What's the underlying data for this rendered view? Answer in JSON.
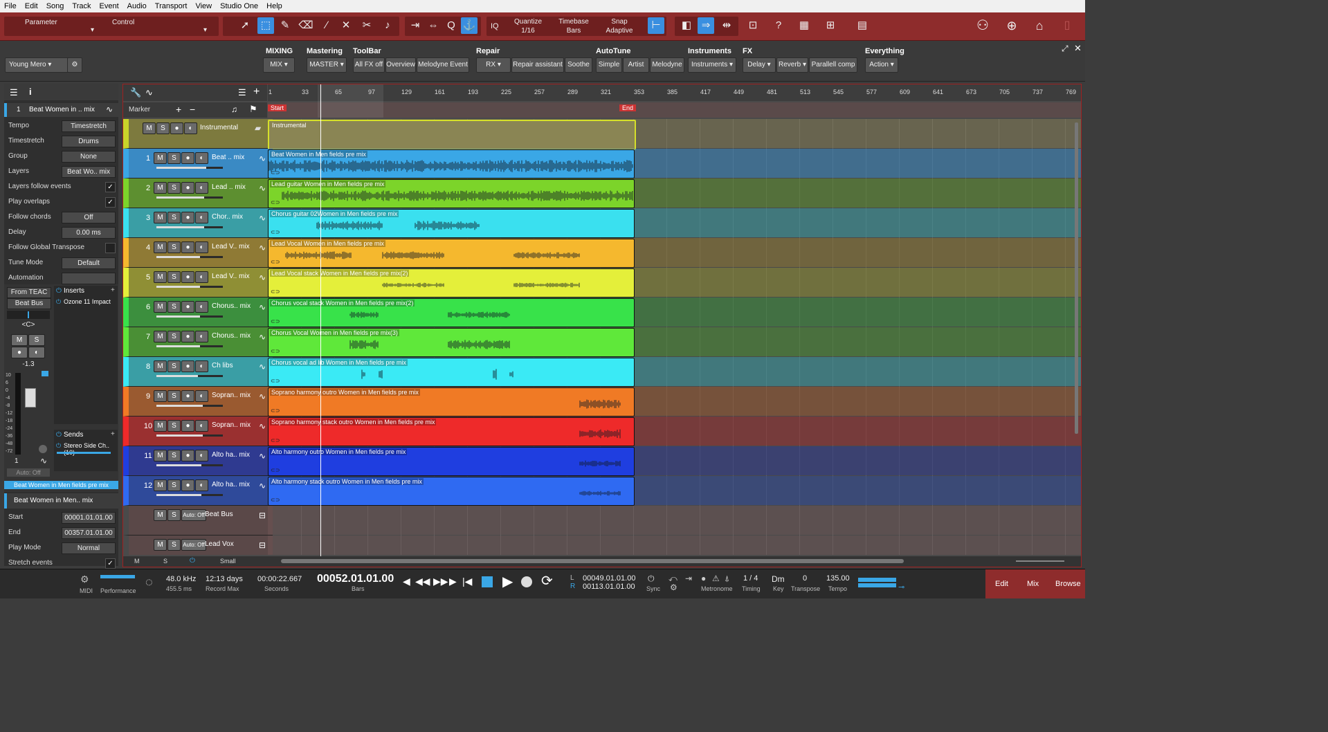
{
  "menu": [
    "File",
    "Edit",
    "Song",
    "Track",
    "Event",
    "Audio",
    "Transport",
    "View",
    "Studio One",
    "Help"
  ],
  "toolbar": {
    "parameter_label": "Parameter",
    "control_label": "Control",
    "quantize_label": "Quantize",
    "quantize_value": "1/16",
    "timebase_label": "Timebase",
    "timebase_value": "Bars",
    "snap_label": "Snap",
    "snap_value": "Adaptive",
    "iq": "IQ"
  },
  "macro": {
    "preset": "Young Mero",
    "groups": [
      {
        "title": "MIXING",
        "buttons": [
          "MIX"
        ]
      },
      {
        "title": "Mastering",
        "buttons": [
          "MASTER"
        ]
      },
      {
        "title": "ToolBar",
        "buttons": [
          "All FX off",
          "Overview",
          "Melodyne Event"
        ]
      },
      {
        "title": "Repair",
        "buttons": [
          "RX",
          "Repair assistant",
          "Soothe"
        ]
      },
      {
        "title": "AutoTune",
        "buttons": [
          "Simple",
          "Artist",
          "Melodyne"
        ]
      },
      {
        "title": "Instruments",
        "buttons": [
          "Instruments"
        ]
      },
      {
        "title": "FX",
        "buttons": [
          "Delay",
          "Reverb",
          "Parallell comp"
        ]
      },
      {
        "title": "Everything",
        "buttons": [
          "Action"
        ]
      }
    ]
  },
  "inspector": {
    "track_num": "1",
    "track_name": "Beat Women in .. mix",
    "rows": [
      {
        "label": "Tempo",
        "value": "Timestretch"
      },
      {
        "label": "Timestretch",
        "value": "Drums"
      },
      {
        "label": "Group",
        "value": "None"
      },
      {
        "label": "Layers",
        "value": "Beat Wo.. mix"
      },
      {
        "label": "Layers follow events",
        "check": "✓"
      },
      {
        "label": "Play overlaps",
        "check": "✓"
      },
      {
        "label": "Follow chords",
        "value": "Off"
      },
      {
        "label": "Delay",
        "value": "0.00 ms"
      },
      {
        "label": "Follow Global Transpose",
        "check": ""
      },
      {
        "label": "Tune Mode",
        "value": "Default"
      },
      {
        "label": "Automation",
        "value": ""
      }
    ],
    "input": "From TEAC",
    "bus": "Beat Bus",
    "pan": "<C>",
    "volume": "-1.3",
    "inserts_title": "Inserts",
    "insert1": "Ozone 11 Impact",
    "sends_title": "Sends",
    "send1": "Stereo Side Ch..(10)",
    "ch_num": "1",
    "auto": "Auto: Off",
    "channel_name": "Beat Women in Men fields pre mix",
    "event_name": "Beat Women in Men.. mix",
    "event_rows": [
      {
        "label": "Start",
        "value": "00001.01.01.00"
      },
      {
        "label": "End",
        "value": "00357.01.01.00"
      },
      {
        "label": "Play Mode",
        "value": "Normal"
      },
      {
        "label": "Stretch events",
        "check": "✓"
      }
    ],
    "meter_scale": [
      "10",
      "6",
      "0",
      "-4",
      "-8",
      "-12",
      "-18",
      "-24",
      "-36",
      "-48",
      "-72"
    ]
  },
  "arrange": {
    "ruler": [
      "1",
      "33",
      "65",
      "97",
      "129",
      "161",
      "193",
      "225",
      "257",
      "289",
      "321",
      "353",
      "385",
      "417",
      "449",
      "481",
      "513",
      "545",
      "577",
      "609",
      "641",
      "673",
      "705",
      "737",
      "769"
    ],
    "marker_label": "Marker",
    "start_label": "Start",
    "end_label": "End",
    "folder": {
      "name": "Instrumental",
      "clip": "Instrumental"
    },
    "tracks": [
      {
        "num": "1",
        "name": "Beat .. mix",
        "clip": "Beat Women in Men fields pre mix",
        "color": "#3aa7e6",
        "hdr": "#3a8ac4",
        "level": 0.75
      },
      {
        "num": "2",
        "name": "Lead .. mix",
        "clip": "Lead guitar Women in Men fields pre mix",
        "color": "#7cd42a",
        "hdr": "#5d8f30",
        "level": 0.72
      },
      {
        "num": "3",
        "name": "Chor.. mix",
        "clip": "Chorus guitar 02Women in Men fields pre mix",
        "color": "#3ae0ef",
        "hdr": "#3a9ea5",
        "level": 0.72
      },
      {
        "num": "4",
        "name": "Lead V.. mix",
        "clip": "Lead Vocal Women in Men fields pre mix",
        "color": "#f5b82e",
        "hdr": "#8f7a35",
        "level": 0.66
      },
      {
        "num": "5",
        "name": "Lead V.. mix",
        "clip": "Lead Vocal stack Women in Men fields pre mix(2)",
        "color": "#e4ef3a",
        "hdr": "#8f8f35",
        "level": 0.66
      },
      {
        "num": "6",
        "name": "Chorus.. mix",
        "clip": "Chorus vocal stack Women in Men fields pre mix(2)",
        "color": "#38e24a",
        "hdr": "#3c8f3e",
        "level": 0.66
      },
      {
        "num": "7",
        "name": "Chorus.. mix",
        "clip": "Chorus Vocal Women in Men fields pre mix(3)",
        "color": "#5fe83a",
        "hdr": "#4a8f35",
        "level": 0.66
      },
      {
        "num": "8",
        "name": "Ch libs",
        "clip": "Chorus vocal ad lib Women in Men fields pre mix",
        "color": "#3aeaf5",
        "hdr": "#3a9ea5",
        "level": 0.62
      },
      {
        "num": "9",
        "name": "Sopran.. mix",
        "clip": "Soprano harmony outro Women in Men fields pre mix",
        "color": "#f07a25",
        "hdr": "#9a5a30",
        "level": 0.7
      },
      {
        "num": "10",
        "name": "Sopran.. mix",
        "clip": "Soprano harmony stack outro Women in Men fields pre mix",
        "color": "#ee2a2a",
        "hdr": "#9a3030",
        "level": 0.7
      },
      {
        "num": "11",
        "name": "Alto ha.. mix",
        "clip": "Alto harmony outro Women in Men fields pre mix",
        "color": "#1f3ee0",
        "hdr": "#2f3a90",
        "level": 0.68
      },
      {
        "num": "12",
        "name": "Alto ha.. mix",
        "clip": "Alto harmony stack outro Women in Men fields pre mix",
        "color": "#2f6af2",
        "hdr": "#2f4a9a",
        "level": 0.68
      }
    ],
    "buses": [
      {
        "name": "Beat Bus",
        "auto": "Auto: Off"
      },
      {
        "name": "Lead Vox",
        "auto": "Auto: Off"
      }
    ],
    "footer": {
      "m": "M",
      "s": "S",
      "size": "Small"
    }
  },
  "transport": {
    "midi": "MIDI",
    "performance": "Performance",
    "rate": "48.0 kHz",
    "latency": "455.5 ms",
    "record_max_val": "12:13 days",
    "record_max": "Record Max",
    "seconds_val": "00:00:22.667",
    "seconds": "Seconds",
    "bars_val": "00052.01.01.00",
    "bars": "Bars",
    "loop_l": "00049.01.01.00",
    "loop_r": "00113.01.01.00",
    "sync": "Sync",
    "metronome": "Metronome",
    "timing_val": "1 / 4",
    "timing": "Timing",
    "key_val": "Dm",
    "key": "Key",
    "transpose_val": "0",
    "transpose": "Transpose",
    "tempo_val": "135.00",
    "tempo": "Tempo",
    "edit": "Edit",
    "mix": "Mix",
    "browse": "Browse"
  }
}
